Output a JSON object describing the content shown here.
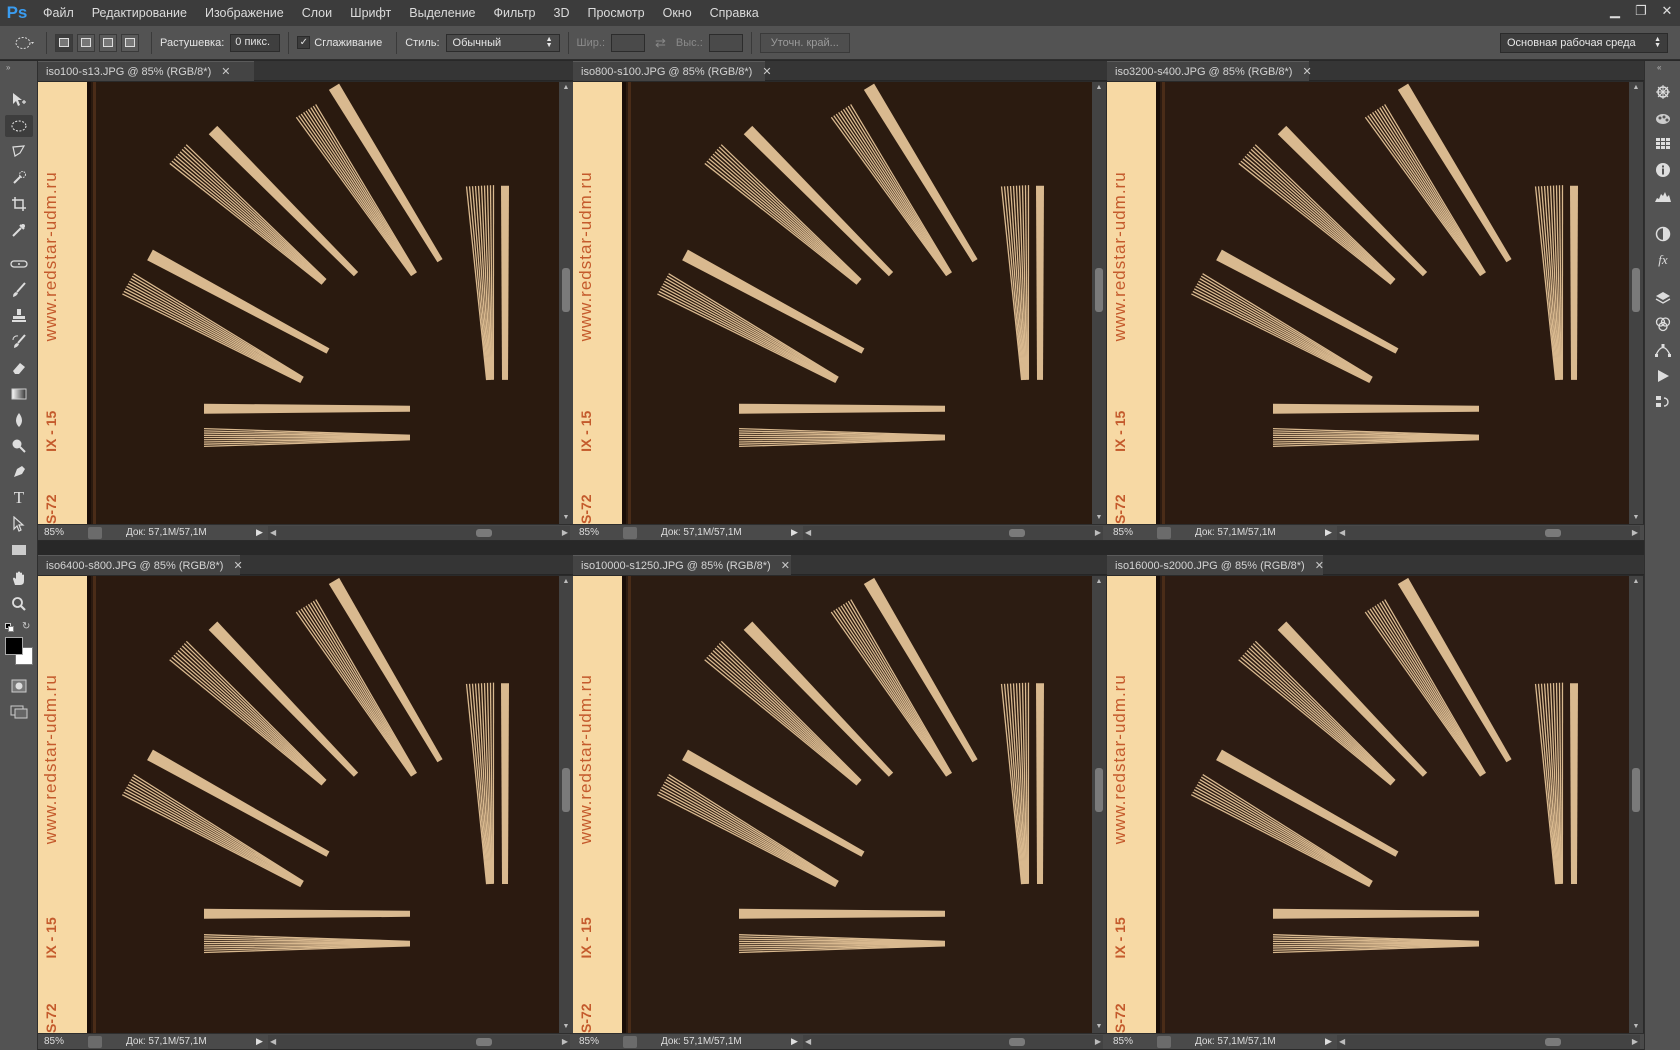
{
  "app": {
    "logo": "Ps",
    "menu": [
      "Файл",
      "Редактирование",
      "Изображение",
      "Слои",
      "Шрифт",
      "Выделение",
      "Фильтр",
      "3D",
      "Просмотр",
      "Окно",
      "Справка"
    ],
    "window_controls": {
      "minimize": "▁",
      "restore": "❐",
      "close": "✕"
    }
  },
  "options": {
    "feather_label": "Растушевка:",
    "feather_value": "0 пикс.",
    "antialias_label": "Сглаживание",
    "antialias_checked": "✓",
    "style_label": "Стиль:",
    "style_value": "Обычный",
    "width_label": "Шир.:",
    "height_label": "Выс.:",
    "refine_edge": "Уточн. край...",
    "workspace": "Основная рабочая среда"
  },
  "documents": [
    {
      "title": "iso100-s13.JPG @ 85% (RGB/8*)",
      "zoom": "85%",
      "doc": "Док: 57,1M/57,1M"
    },
    {
      "title": "iso800-s100.JPG @ 85% (RGB/8*)",
      "zoom": "85%",
      "doc": "Док: 57,1M/57,1M"
    },
    {
      "title": "iso3200-s400.JPG @ 85% (RGB/8*)",
      "zoom": "85%",
      "doc": "Док: 57,1M/57,1M"
    },
    {
      "title": "iso6400-s800.JPG @ 85% (RGB/8*)",
      "zoom": "85%",
      "doc": "Док: 57,1M/57,1M"
    },
    {
      "title": "iso10000-s1250.JPG @ 85% (RGB/8*)",
      "zoom": "85%",
      "doc": "Док: 57,1M/57,1M"
    },
    {
      "title": "iso16000-s2000.JPG @ 85% (RGB/8*)",
      "zoom": "85%",
      "doc": "Док: 57,1M/57,1M"
    }
  ],
  "canvas_text": {
    "website": "www.redstar-udm.ru",
    "film_label_1": "IX - 15",
    "film_label_2": "S-72"
  },
  "colors": {
    "film_strip": "#f7d9a4",
    "film_text": "#c45a2c",
    "background": "#2b1a0f",
    "wedge": "#d9b98f",
    "foreground_swatch": "#000000",
    "background_swatch": "#ffffff"
  }
}
